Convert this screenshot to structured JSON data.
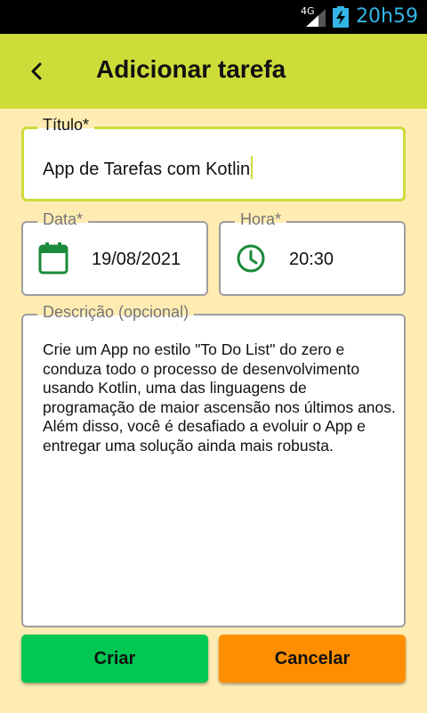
{
  "status_bar": {
    "network": "4G",
    "time": "20h59"
  },
  "app_bar": {
    "title": "Adicionar tarefa",
    "back_icon": "chevron-left-icon",
    "color": "#cddc39"
  },
  "form": {
    "title_field": {
      "label": "Título*",
      "value": "App de Tarefas com Kotlin"
    },
    "date_field": {
      "label": "Data*",
      "value": "19/08/2021",
      "icon": "calendar-icon"
    },
    "time_field": {
      "label": "Hora*",
      "value": "20:30",
      "icon": "clock-icon"
    },
    "description_field": {
      "label": "Descrição (opcional)",
      "value": "Crie um App no estilo \"To Do List\" do zero e conduza todo o processo de desenvolvimento usando Kotlin, uma das linguagens de programação de maior ascensão nos últimos anos. Além disso, você é desafiado a evoluir o App e entregar uma solução ainda mais robusta."
    }
  },
  "actions": {
    "create_label": "Criar",
    "cancel_label": "Cancelar",
    "create_color": "#00c853",
    "cancel_color": "#ff8f00"
  },
  "colors": {
    "background": "#ffecb3",
    "icon_green": "#1b8a3a"
  }
}
